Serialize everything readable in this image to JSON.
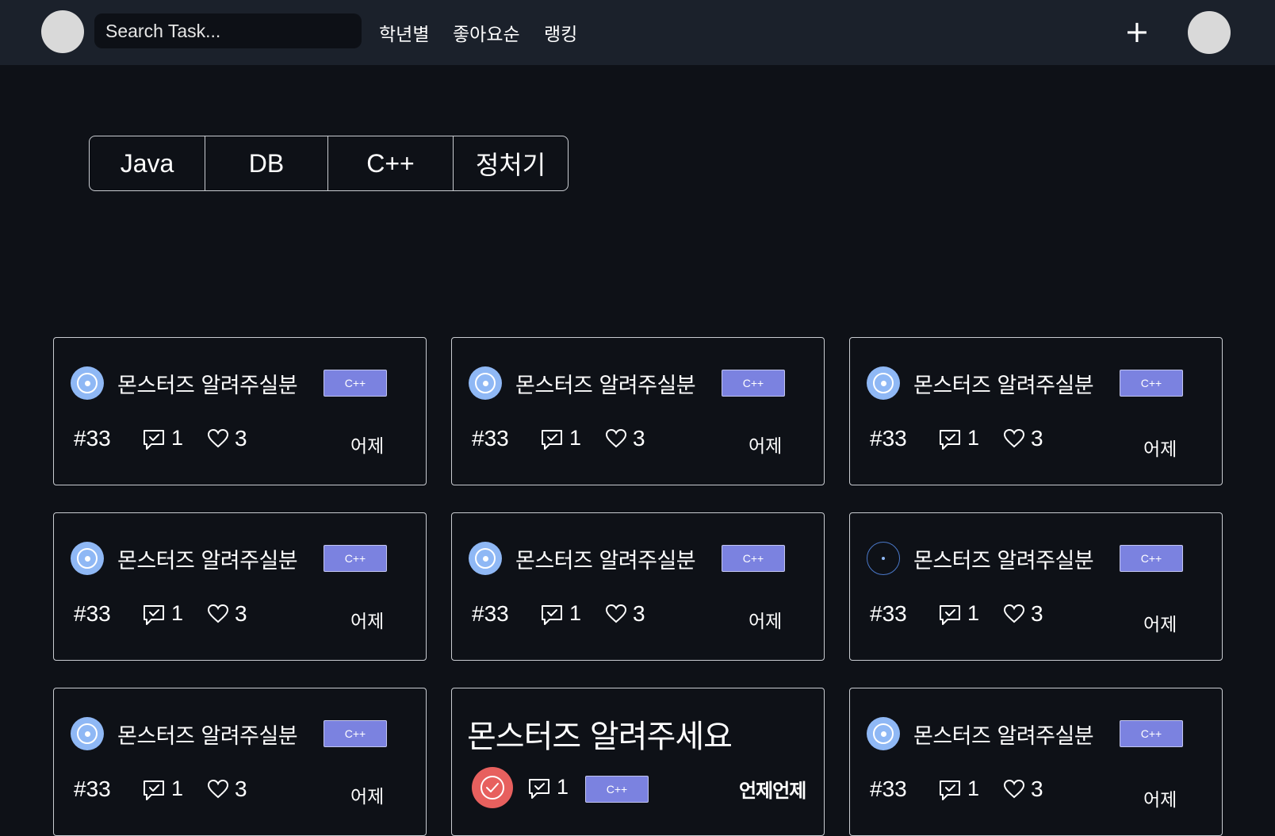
{
  "header": {
    "search_placeholder": "Search Task...",
    "nav": [
      "학년별",
      "좋아요순",
      "랭킹"
    ],
    "add_label": "+"
  },
  "tabs": [
    "Java",
    "DB",
    "C++",
    "정처기"
  ],
  "cards": [
    {
      "title": "몬스터즈 알려주실분",
      "tag": "C++",
      "number": "#33",
      "comments": "1",
      "likes": "3",
      "date": "어제",
      "status": "in-progress"
    },
    {
      "title": "몬스터즈 알려주실분",
      "tag": "C++",
      "number": "#33",
      "comments": "1",
      "likes": "3",
      "date": "어제",
      "status": "in-progress"
    },
    {
      "title": "몬스터즈 알려주실분",
      "tag": "C++",
      "number": "#33",
      "comments": "1",
      "likes": "3",
      "date": "어제",
      "status": "in-progress"
    },
    {
      "title": "몬스터즈 알려주실분",
      "tag": "C++",
      "number": "#33",
      "comments": "1",
      "likes": "3",
      "date": "어제",
      "status": "in-progress"
    },
    {
      "title": "몬스터즈 알려주실분",
      "tag": "C++",
      "number": "#33",
      "comments": "1",
      "likes": "3",
      "date": "어제",
      "status": "in-progress"
    },
    {
      "title": "몬스터즈 알려주실분",
      "tag": "C++",
      "number": "#33",
      "comments": "1",
      "likes": "3",
      "date": "어제",
      "status": "open"
    },
    {
      "title": "몬스터즈 알려주실분",
      "tag": "C++",
      "number": "#33",
      "comments": "1",
      "likes": "3",
      "date": "어제",
      "status": "in-progress"
    },
    {
      "title": "몬스터즈 알려주세요",
      "tag": "C++",
      "comments": "1",
      "date": "언제언제",
      "status": "done"
    },
    {
      "title": "몬스터즈 알려주실분",
      "tag": "C++",
      "number": "#33",
      "comments": "1",
      "likes": "3",
      "date": "어제",
      "status": "in-progress"
    }
  ],
  "colors": {
    "background": "#0e1117",
    "topbar": "#1b212b",
    "tag": "#7b82e0",
    "status_in_progress": "#8fb8f5",
    "status_done": "#e7605e"
  }
}
